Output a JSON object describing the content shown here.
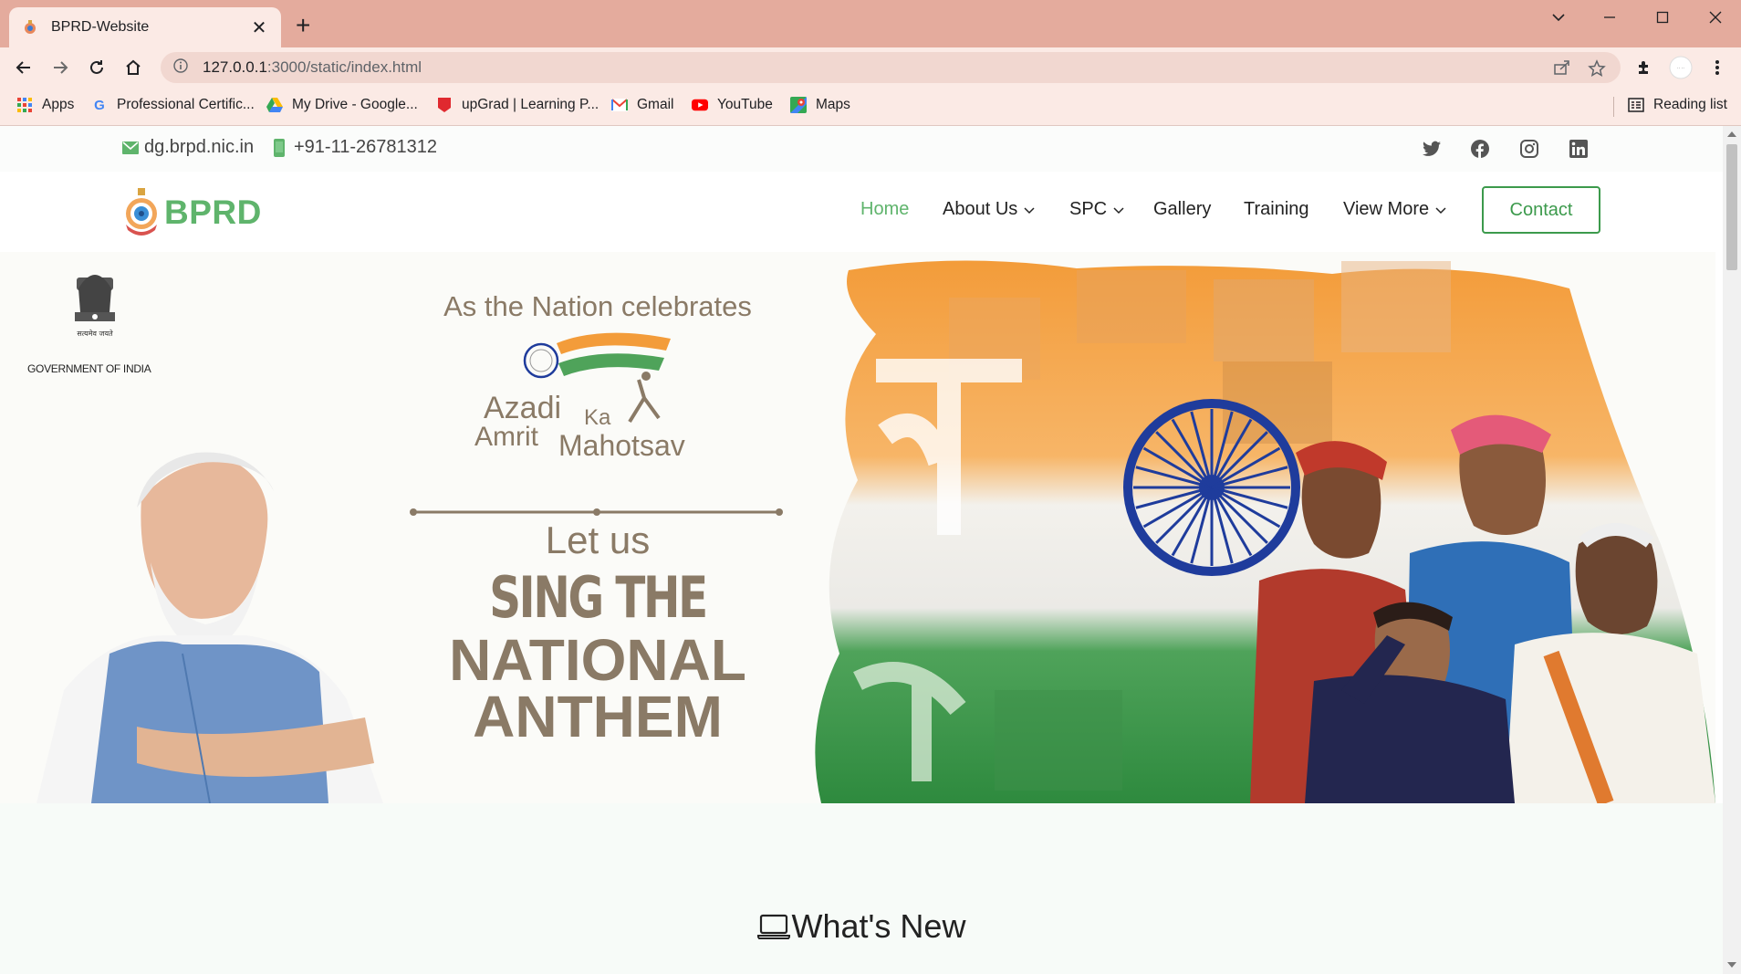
{
  "browser": {
    "tab_title": "BPRD-Website",
    "url_host": "127.0.0.1",
    "url_rest": ":3000/static/index.html",
    "bookmarks": [
      {
        "label": "Apps",
        "icon": "apps-grid-icon"
      },
      {
        "label": "Professional Certific...",
        "icon": "google-icon"
      },
      {
        "label": "My Drive - Google...",
        "icon": "google-drive-icon"
      },
      {
        "label": "upGrad | Learning P...",
        "icon": "upgrad-icon"
      },
      {
        "label": "Gmail",
        "icon": "gmail-icon"
      },
      {
        "label": "YouTube",
        "icon": "youtube-icon"
      },
      {
        "label": "Maps",
        "icon": "maps-icon"
      }
    ],
    "reading_list": "Reading list"
  },
  "topbar": {
    "email": "dg.brpd.nic.in",
    "phone": "+91-11-26781312",
    "social": [
      "twitter-icon",
      "facebook-icon",
      "instagram-icon",
      "linkedin-icon"
    ]
  },
  "navbar": {
    "logo_text": "BPRD",
    "items": [
      {
        "label": "Home",
        "active": true,
        "dropdown": false
      },
      {
        "label": "About Us",
        "active": false,
        "dropdown": true
      },
      {
        "label": "SPC",
        "active": false,
        "dropdown": true
      },
      {
        "label": "Gallery",
        "active": false,
        "dropdown": false
      },
      {
        "label": "Training",
        "active": false,
        "dropdown": false
      },
      {
        "label": "View More",
        "active": false,
        "dropdown": true
      }
    ],
    "contact_label": "Contact"
  },
  "hero": {
    "goi_text": "GOVERNMENT OF INDIA",
    "line1": "As the Nation celebrates",
    "azadi": "Azadi",
    "ka": "Ka",
    "amrit": "Amrit",
    "mahotsav": "Mahotsav",
    "let_us": "Let us",
    "sing_the": "SING THE",
    "national": "NATIONAL",
    "anthem": "ANTHEM"
  },
  "section": {
    "title": "What's New"
  },
  "colors": {
    "brand_green": "#5fb46c",
    "chrome_titlebar": "#e4ab9d",
    "chrome_toolbar": "#fbeae5"
  }
}
